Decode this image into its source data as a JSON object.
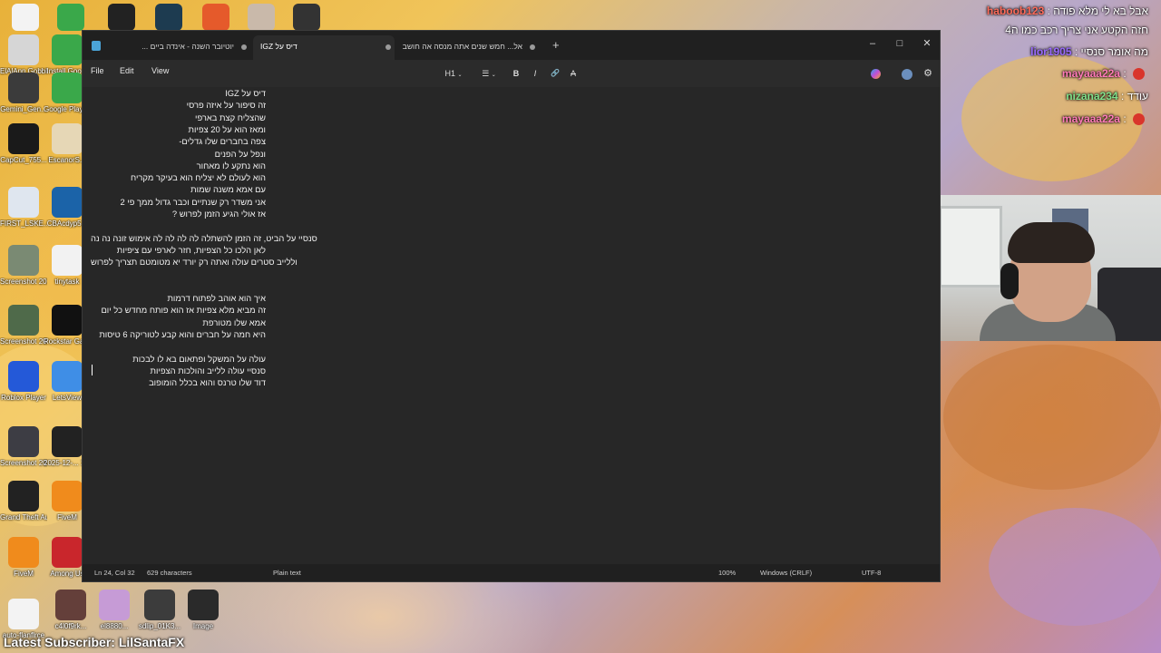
{
  "desktop": {
    "top_icons": [
      {
        "label": "",
        "color": "#f3f3f3"
      },
      {
        "label": "",
        "color": "#3aa84a"
      },
      {
        "label": "",
        "color": "#222222"
      },
      {
        "label": "",
        "color": "#1d3b50"
      },
      {
        "label": "",
        "color": "#e55a2b"
      },
      {
        "label": "",
        "color": "#c9b9aa"
      },
      {
        "label": "",
        "color": "#333333"
      }
    ],
    "left_icons_col1": [
      {
        "label": "ElAlAnn Gobblemo..",
        "color": "#d6d6d6"
      },
      {
        "label": "Gemini_Gen...",
        "color": "#3b3b3b"
      },
      {
        "label": "CapCut_755...",
        "color": "#1a1a1a"
      },
      {
        "label": "FIRST_LSKE...",
        "color": "#dfe6ef"
      },
      {
        "label": "Screenshot 2025-10-...",
        "color": "#7a8a73"
      },
      {
        "label": "Screenshot 2025-10-...",
        "color": "#4f6a4a"
      },
      {
        "label": "Roblox Player",
        "color": "#2459d8"
      },
      {
        "label": "Screenshot 2025-1-1...",
        "color": "#3d3d44"
      },
      {
        "label": "Grand Theft Auto V",
        "color": "#222222"
      },
      {
        "label": "FiveM",
        "color": "#f08b1c"
      },
      {
        "label": "auto-flanflrce",
        "color": "#f3f3f3"
      }
    ],
    "left_icons_col2": [
      {
        "label": "Install Goo...",
        "color": "#3aa84a"
      },
      {
        "label": "Google Play Games Ri...",
        "color": "#3aa84a"
      },
      {
        "label": "EscanorS...",
        "color": "#e6d7b6"
      },
      {
        "label": "CBAcdyp5...",
        "color": "#1b63a8"
      },
      {
        "label": "tinytask",
        "color": "#f2f2f2"
      },
      {
        "label": "Rockstar Games...",
        "color": "#111111"
      },
      {
        "label": "LetsView",
        "color": "#3f8ee6"
      },
      {
        "label": "2025-12-... 17-26-1...",
        "color": "#222222"
      },
      {
        "label": "FiveM",
        "color": "#f08b1c"
      },
      {
        "label": "Among Us",
        "color": "#c9262c"
      },
      {
        "label": "c4l0f9rk...",
        "color": "#643f3a"
      },
      {
        "label": "el8880...",
        "color": "#c69bd6"
      },
      {
        "label": "sdlip_01K3...",
        "color": "#3c3c3c"
      },
      {
        "label": "Image",
        "color": "#2a2a2a"
      }
    ]
  },
  "chat": {
    "messages": [
      {
        "user": "haboob123",
        "text": "אבל בא לי מלא פודה :",
        "color": "#ff6b5a"
      },
      {
        "user": "",
        "text": "חזה הקטע אני צריך רכב כמו ה4",
        "color": "#ffffff"
      },
      {
        "user": "lior1905",
        "text": "מה אומר סנסיי :",
        "color": "#9b6bff"
      },
      {
        "user": "mayaaa22a",
        "text": ":",
        "color": "#ff7ab8"
      },
      {
        "user": "nizana234",
        "text": "עודד :",
        "color": "#7fe08a"
      },
      {
        "user": "mayaaa22a",
        "text": ":",
        "color": "#ff7ab8"
      }
    ]
  },
  "notepad": {
    "tabs": [
      {
        "title": "יוטיובר השנה - אינדה ביים ..."
      },
      {
        "title": "דיס על IGZ"
      },
      {
        "title": "אל... חמש שנים אתה מנסה אה חושב"
      }
    ],
    "new_tab_label": "+",
    "window_controls": {
      "minimize": "–",
      "maximize": "□",
      "close": "✕"
    },
    "menu": {
      "file": "File",
      "edit": "Edit",
      "view": "View"
    },
    "toolbar": {
      "heading": "H1",
      "list": "☰",
      "bold": "B",
      "italic": "I",
      "link": "🔗",
      "format": "A"
    },
    "lines": [
      "דיס על IGZ",
      "זה סיפור על איזה פרסי",
      "שהצליח קצת בארפי",
      "ומאז הוא על 20 צפיות",
      "צפה בחברים שלו גדלים-",
      "ונפל על הפנים",
      "הוא נתקע לו מאחור",
      "הוא לעולם לא יצליח הוא בעיקר מקריח",
      "עם אמא משנה שמות",
      "אני משדר רק שנתיים וכבר גדול ממך פי 2",
      "אז אולי הגיע הזמן לפרוש ?",
      "",
      "סנסיי על הביט, זה הזמן להשתלה לה לה לה לה אימוש זונה נה נה",
      "לאן הלכו כל הצפיות, חזר לארפי עם ציפיות",
      "וללייב סטרים עולה ואתה רק יורד יא מטומטם תצריך לפרוש",
      "",
      "",
      "איך הוא אוהב לפתוח דרמות",
      "זה מביא מלא צפיות אז הוא פותח מחדש כל יום",
      "אמא שלו מטורפת",
      "היא חמה על חברים והוא קבע לטוריקה 6 טיסות",
      "",
      "עולה על המשקל ופתאום בא לו לבכות",
      "סנסיי עולה ללייב והולכות הצפיות",
      "דוד שלו טרנס והוא בכלל הומופוב"
    ],
    "status": {
      "position": "Ln 24, Col 32",
      "chars": "629 characters",
      "format": "Plain text",
      "zoom": "100%",
      "line_ending": "Windows (CRLF)",
      "encoding": "UTF-8"
    }
  },
  "banner": "Latest Subscriber: LilSantaFX"
}
